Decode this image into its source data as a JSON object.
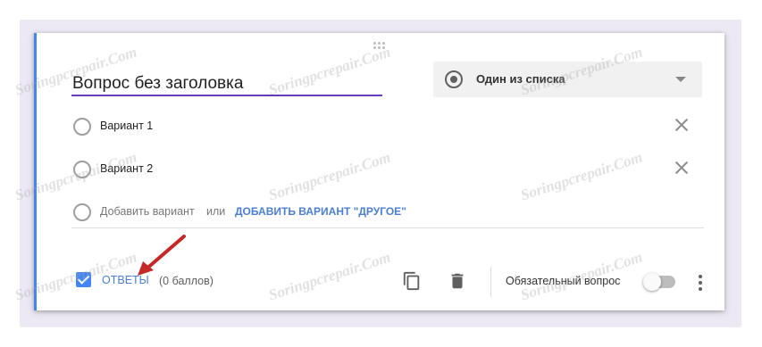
{
  "question": {
    "title": "Вопрос без заголовка",
    "type_label": "Один из списка"
  },
  "options": [
    {
      "label": "Вариант 1"
    },
    {
      "label": "Вариант 2"
    }
  ],
  "add_option": {
    "label": "Добавить вариант",
    "or": "или",
    "add_other": "ДОБАВИТЬ ВАРИАНТ \"ДРУГОЕ\""
  },
  "footer": {
    "answers_label": "ОТВЕТЫ",
    "points_label": "(0 баллов)",
    "required_label": "Обязательный вопрос",
    "answers_checked": true,
    "required_on": false
  },
  "watermark": "Soringpcrepair.Com",
  "colors": {
    "accent_blue": "#4285f4",
    "title_underline": "#673ab7",
    "link_blue": "#4a7fd6",
    "arrow_red": "#c62828"
  }
}
